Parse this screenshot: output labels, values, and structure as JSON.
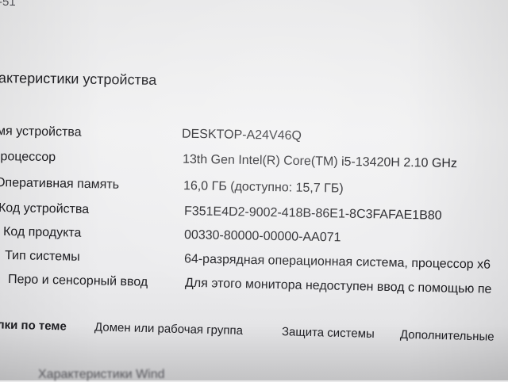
{
  "header": {
    "fragment": "-51"
  },
  "section": {
    "title": "рактеристики устройства"
  },
  "specs": [
    {
      "label": "мя устройства",
      "value": "DESKTOP-A24V46Q"
    },
    {
      "label": "Іроцессор",
      "value": "13th Gen Intel(R) Core(TM) i5-13420H   2.10 GHz"
    },
    {
      "label": "Оперативная память",
      "value": "16,0 ГБ (доступно: 15,7 ГБ)"
    },
    {
      "label": "Код устройства",
      "value": "F351E4D2-9002-418B-86E1-8C3FAFAE1B80"
    },
    {
      "label": "Код продукта",
      "value": "00330-80000-00000-AA071"
    },
    {
      "label": "Тип системы",
      "value": "64-разрядная операционная система, процессор x6"
    },
    {
      "label": "Перо и сенсорный ввод",
      "value": "Для этого монитора недоступен ввод с помощью пе"
    }
  ],
  "related_links": {
    "heading": "лки по теме",
    "items": [
      "Домен или рабочая группа",
      "Защита системы",
      "Дополнительные"
    ]
  },
  "bottom": {
    "fragment": "Характеристики Wind"
  }
}
